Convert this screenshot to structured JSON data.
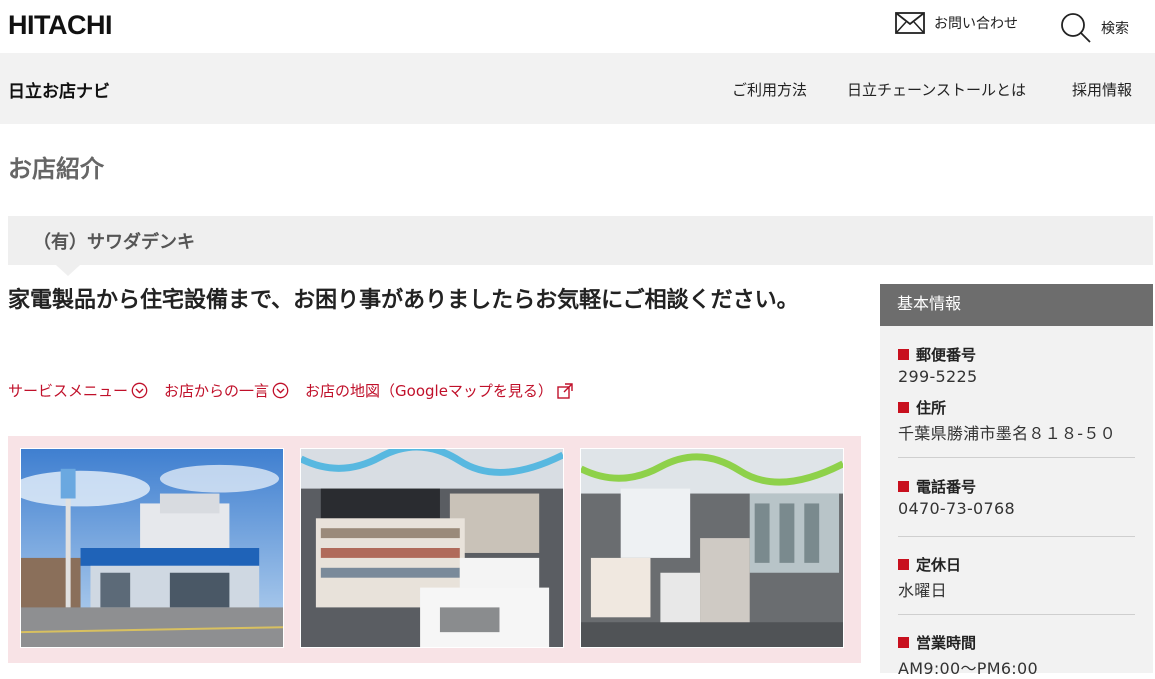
{
  "header": {
    "logo": "HITACHI",
    "contact_label": "お問い合わせ",
    "search_label": "検索"
  },
  "nav": {
    "site_title": "日立お店ナビ",
    "items": [
      "ご利用方法",
      "日立チェーンストールとは",
      "採用情報"
    ]
  },
  "page": {
    "heading": "お店紹介",
    "shop_name": "（有）サワダデンキ",
    "catchphrase": "家電製品から住宅設備まで、お困り事がありましたらお気軽にご相談ください。",
    "links": [
      "サービスメニュー",
      "お店からの一言",
      "お店の地図（Googleマップを見る）"
    ]
  },
  "sidebar": {
    "title": "基本情報",
    "items": [
      {
        "label": "郵便番号",
        "value": "299-5225"
      },
      {
        "label": "住所",
        "value": "千葉県勝浦市墨名８１８-５０"
      },
      {
        "label": "電話番号",
        "value": "0470-73-0768"
      },
      {
        "label": "定休日",
        "value": "水曜日"
      },
      {
        "label": "営業時間",
        "value": "AM9:00～PM6:00"
      }
    ]
  },
  "colors": {
    "accent_red": "#c0102a",
    "gallery_bg": "#f8e3e6",
    "sidebar_head": "#6d6d6d"
  }
}
